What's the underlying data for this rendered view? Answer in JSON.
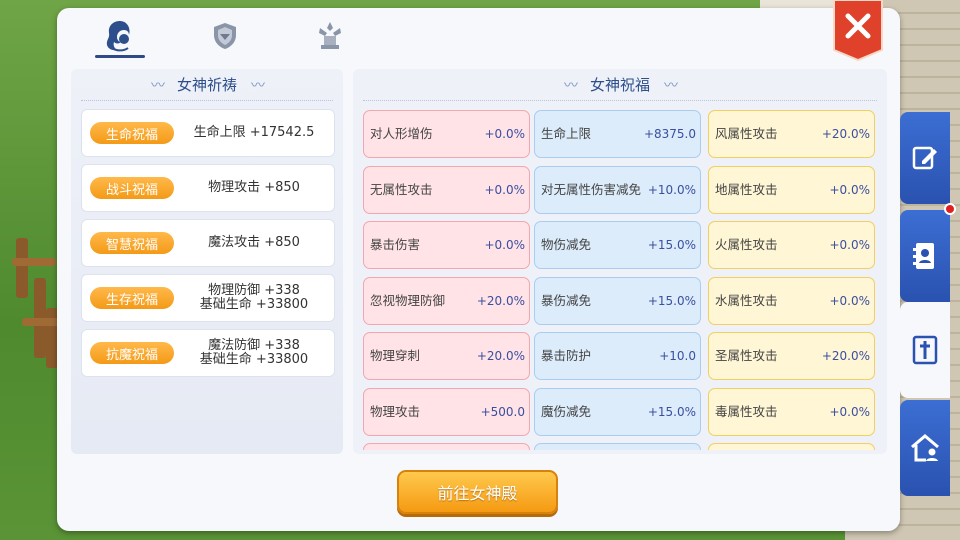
{
  "tabs": [
    {
      "icon": "goddess-icon",
      "active": true
    },
    {
      "icon": "shield-icon",
      "active": false
    },
    {
      "icon": "emblem-icon",
      "active": false
    }
  ],
  "left": {
    "title": "女神祈祷",
    "items": [
      {
        "badge": "生命祝福",
        "line1": "生命上限 +17542.5",
        "line2": ""
      },
      {
        "badge": "战斗祝福",
        "line1": "物理攻击 +850",
        "line2": ""
      },
      {
        "badge": "智慧祝福",
        "line1": "魔法攻击 +850",
        "line2": ""
      },
      {
        "badge": "生存祝福",
        "line1": "物理防御 +338",
        "line2": "基础生命 +33800"
      },
      {
        "badge": "抗魔祝福",
        "line1": "魔法防御 +338",
        "line2": "基础生命 +33800"
      }
    ]
  },
  "right": {
    "title": "女神祝福",
    "columns": [
      [
        {
          "name": "对人形增伤",
          "value": "+0.0%"
        },
        {
          "name": "无属性攻击",
          "value": "+0.0%"
        },
        {
          "name": "暴击伤害",
          "value": "+0.0%"
        },
        {
          "name": "忽视物理防御",
          "value": "+20.0%"
        },
        {
          "name": "物理穿刺",
          "value": "+20.0%"
        },
        {
          "name": "物理攻击",
          "value": "+500.0"
        }
      ],
      [
        {
          "name": "生命上限",
          "value": "+8375.0"
        },
        {
          "name": "对无属性伤害减免",
          "value": "+10.0%"
        },
        {
          "name": "物伤减免",
          "value": "+15.0%"
        },
        {
          "name": "暴伤减免",
          "value": "+15.0%"
        },
        {
          "name": "暴击防护",
          "value": "+10.0"
        },
        {
          "name": "魔伤减免",
          "value": "+15.0%"
        }
      ],
      [
        {
          "name": "风属性攻击",
          "value": "+20.0%"
        },
        {
          "name": "地属性攻击",
          "value": "+0.0%"
        },
        {
          "name": "火属性攻击",
          "value": "+0.0%"
        },
        {
          "name": "水属性攻击",
          "value": "+0.0%"
        },
        {
          "name": "圣属性攻击",
          "value": "+20.0%"
        },
        {
          "name": "毒属性攻击",
          "value": "+0.0%"
        }
      ]
    ]
  },
  "go_button": "前往女神殿",
  "side_tabs": [
    {
      "icon": "edit-icon",
      "active": false,
      "badge": false
    },
    {
      "icon": "contacts-icon",
      "active": false,
      "badge": true
    },
    {
      "icon": "cross-icon",
      "active": true,
      "badge": false
    },
    {
      "icon": "guild-house-icon",
      "active": false,
      "badge": false
    }
  ],
  "colors": {
    "accent": "#2d4f8c",
    "badge": "#f49a17",
    "close": "#e0412b"
  }
}
